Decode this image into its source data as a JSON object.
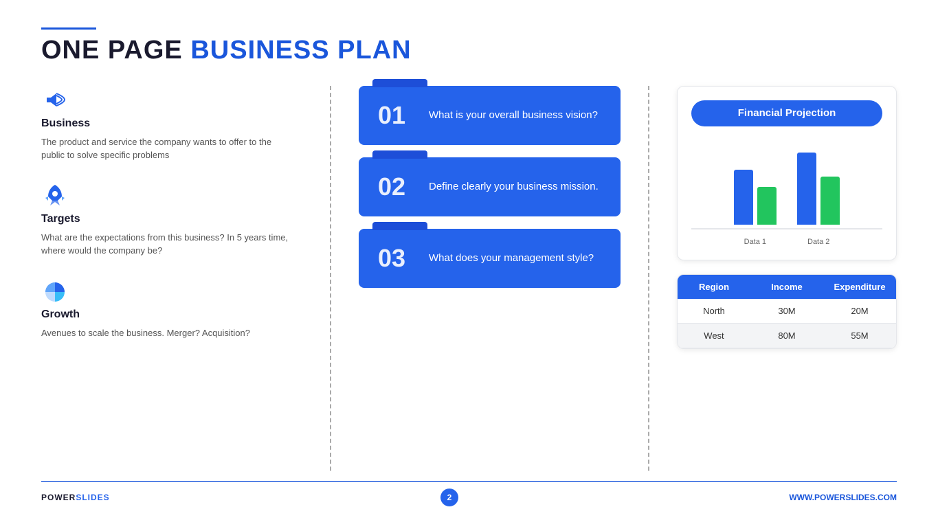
{
  "header": {
    "line": true,
    "title_part1": "ONE PAGE ",
    "title_part2": "BUSINESS PLAN"
  },
  "left": {
    "sections": [
      {
        "id": "business",
        "icon": "megaphone",
        "title": "Business",
        "text": "The product and service the company wants to offer to the public to solve specific problems"
      },
      {
        "id": "targets",
        "icon": "rocket",
        "title": "Targets",
        "text": "What are the expectations from this business? In 5 years time, where would the company be?"
      },
      {
        "id": "growth",
        "icon": "pie",
        "title": "Growth",
        "text": "Avenues to scale the business. Merger? Acquisition?"
      }
    ]
  },
  "cards": [
    {
      "number": "01",
      "text": "What is your overall business vision?"
    },
    {
      "number": "02",
      "text": "Define clearly your business mission."
    },
    {
      "number": "03",
      "text": "What does your management style?"
    }
  ],
  "financial": {
    "title": "Financial Projection",
    "chart": {
      "groups": [
        {
          "label": "Data 1",
          "bar_blue_height": 80,
          "bar_green_height": 55
        },
        {
          "label": "Data 2",
          "bar_blue_height": 105,
          "bar_green_height": 70
        }
      ]
    },
    "table": {
      "headers": [
        "Region",
        "Income",
        "Expenditure"
      ],
      "rows": [
        {
          "region": "North",
          "income": "30M",
          "expenditure": "20M",
          "shaded": false
        },
        {
          "region": "West",
          "income": "80M",
          "expenditure": "55M",
          "shaded": true
        }
      ]
    }
  },
  "footer": {
    "brand_part1": "POWER",
    "brand_part2": "SLIDES",
    "page": "2",
    "website": "WWW.POWERSLIDES.COM"
  }
}
